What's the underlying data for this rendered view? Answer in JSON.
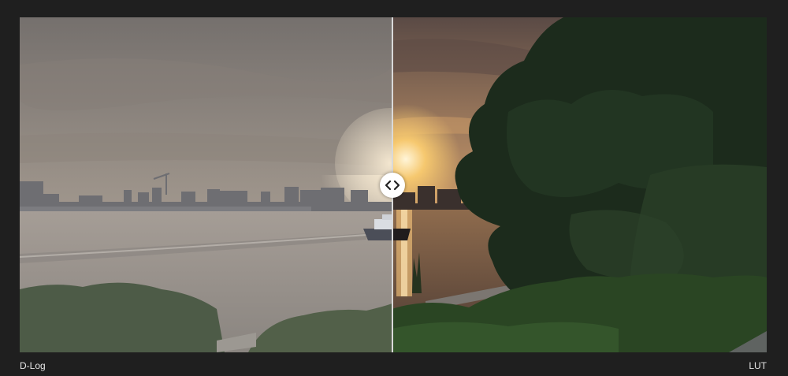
{
  "comparison": {
    "left_label": "D-Log",
    "right_label": "LUT",
    "split_position_percent": 50,
    "handle_icon": "chevrons-left-right-icon"
  },
  "colors": {
    "page_background": "#1f1f1f",
    "divider": "#d9d9d9",
    "handle": "#ffffff",
    "label_text": "#e6e6e6"
  }
}
